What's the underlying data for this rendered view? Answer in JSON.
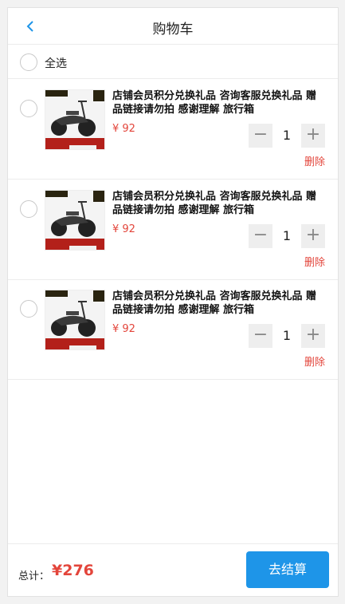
{
  "header": {
    "title": "购物车"
  },
  "select_all": {
    "label": "全选"
  },
  "items": [
    {
      "title": "店铺会员积分兑换礼品 咨询客服兑换礼品 赠品链接请勿拍 感谢理解 旅行箱",
      "price": "¥ 92",
      "quantity": "1",
      "minus": "−",
      "plus": "+",
      "delete_label": "删除"
    },
    {
      "title": "店铺会员积分兑换礼品 咨询客服兑换礼品 赠品链接请勿拍 感谢理解 旅行箱",
      "price": "¥ 92",
      "quantity": "1",
      "minus": "−",
      "plus": "+",
      "delete_label": "删除"
    },
    {
      "title": "店铺会员积分兑换礼品 咨询客服兑换礼品 赠品链接请勿拍 感谢理解 旅行箱",
      "price": "¥ 92",
      "quantity": "1",
      "minus": "−",
      "plus": "+",
      "delete_label": "删除"
    }
  ],
  "footer": {
    "total_label": "总计：",
    "total_value": "¥276",
    "checkout_label": "去结算"
  },
  "colors": {
    "accent": "#1e95e8",
    "price": "#e3453b"
  },
  "icons": {
    "back": "chevron-left-icon"
  }
}
